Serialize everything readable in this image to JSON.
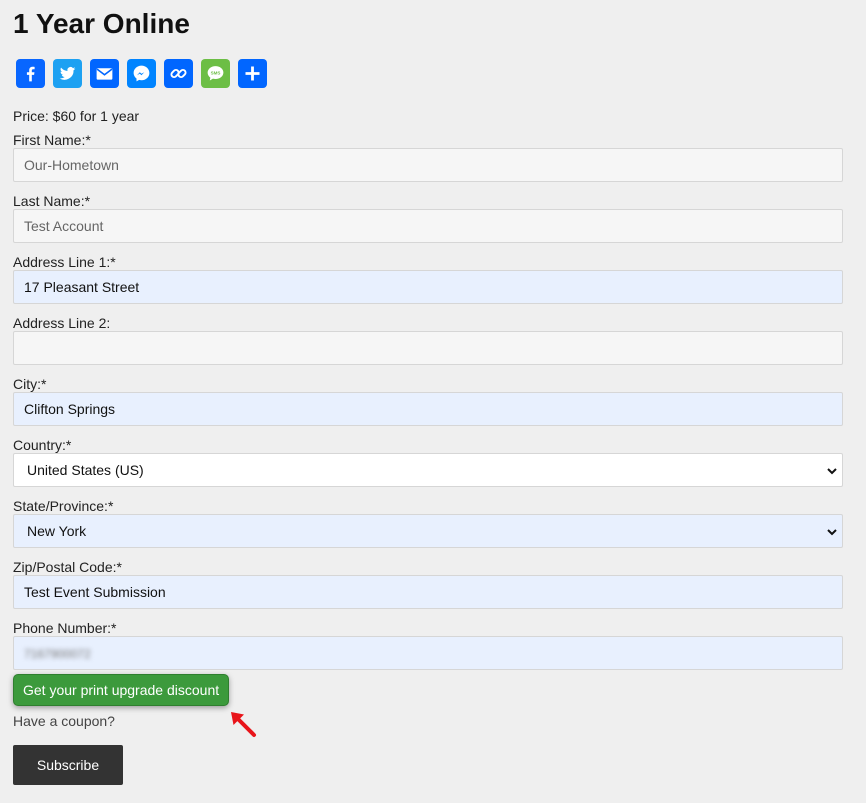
{
  "page": {
    "title": "1 Year Online",
    "price": "Price: $60 for 1 year"
  },
  "share_icons": [
    "facebook-icon",
    "twitter-icon",
    "email-icon",
    "messenger-icon",
    "copy-link-icon",
    "sms-icon",
    "share-more-icon"
  ],
  "sms_icon_text": "SMS",
  "form": {
    "first_name": {
      "label": "First Name:*",
      "value": "Our-Hometown"
    },
    "last_name": {
      "label": "Last Name:*",
      "value": "Test Account"
    },
    "address1": {
      "label": "Address Line 1:*",
      "value": "17 Pleasant Street"
    },
    "address2": {
      "label": "Address Line 2:",
      "value": ""
    },
    "city": {
      "label": "City:*",
      "value": "Clifton Springs"
    },
    "country": {
      "label": "Country:*",
      "value": "United States (US)"
    },
    "state": {
      "label": "State/Province:*",
      "value": "New York"
    },
    "zip": {
      "label": "Zip/Postal Code:*",
      "value": "Test Event Submission"
    },
    "phone": {
      "label": "Phone Number:*",
      "value": "7167900072"
    }
  },
  "actions": {
    "upgrade_label": "Get your print upgrade discount",
    "coupon_label": "Have a coupon?",
    "subscribe_label": "Subscribe"
  },
  "colors": {
    "accent_green": "#3c9a3c",
    "annotation_arrow": "#e8141a",
    "autofill_blue": "#e8f0fe",
    "subscribe_dark": "#333333"
  }
}
